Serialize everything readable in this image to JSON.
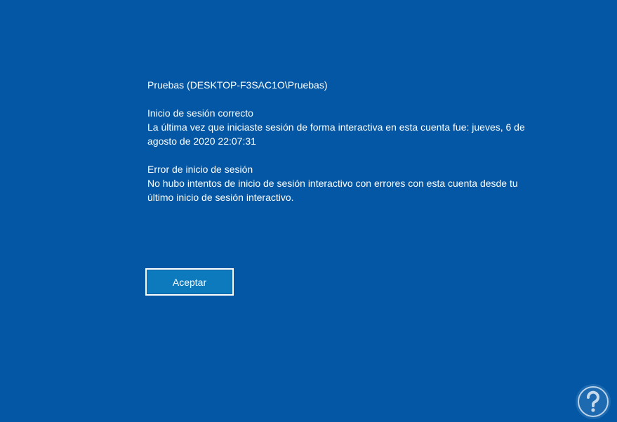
{
  "account": {
    "name": "Pruebas (DESKTOP-F3SAC1O\\Pruebas)"
  },
  "success": {
    "title": "Inicio de sesión correcto",
    "message": "La última vez que iniciaste sesión de forma interactiva en esta cuenta fue: jueves, 6 de agosto de 2020 22:07:31"
  },
  "failure": {
    "title": "Error de inicio de sesión",
    "message": "No hubo intentos de inicio de sesión interactivo con errores con esta cuenta desde tu último inicio de sesión interactivo."
  },
  "button": {
    "label": "Aceptar"
  },
  "colors": {
    "background": "#0457a4",
    "button_fill": "#0e7abe",
    "text": "#ffffff"
  },
  "watermark": {
    "icon": "solvetic-logo"
  }
}
